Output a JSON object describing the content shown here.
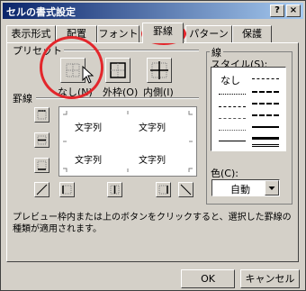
{
  "window": {
    "title": "セルの書式設定"
  },
  "title_buttons": {
    "help": "?",
    "close": "×"
  },
  "tabs": [
    {
      "label": "表示形式"
    },
    {
      "label": "配置"
    },
    {
      "label": "フォント"
    },
    {
      "label": "罫線",
      "active": true
    },
    {
      "label": "パターン"
    },
    {
      "label": "保護"
    }
  ],
  "presets": {
    "heading": "プリセット",
    "none_label": "なし(N)",
    "outline_label": "外枠(O)",
    "inside_label": "内側(I)"
  },
  "border": {
    "heading": "罫線",
    "preview_text": "文字列"
  },
  "line": {
    "group_label": "線",
    "style_label": "スタイル(S):",
    "none_text": "なし",
    "color_label": "色(C):",
    "color_value": "自動"
  },
  "hint": "プレビュー枠内または上のボタンをクリックすると、選択した罫線の種類が適用されます。",
  "buttons": {
    "ok": "OK",
    "cancel": "キャンセル"
  },
  "colors": {
    "annotation": "#e3262b",
    "titlebar": "#0a246a",
    "face": "#d4d0c8"
  }
}
